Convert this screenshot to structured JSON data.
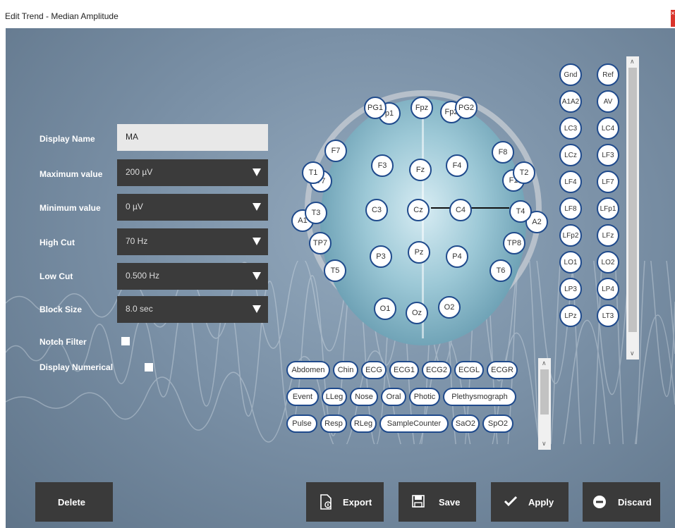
{
  "window": {
    "title": "Edit Trend - Median Amplitude",
    "close_glyph": "×"
  },
  "form": {
    "display_name_label": "Display Name",
    "display_name_value": "MA",
    "max_label": "Maximum value",
    "max_value": "200 µV",
    "min_label": "Minimum value",
    "min_value": "0 µV",
    "high_cut_label": "High Cut",
    "high_cut_value": "70 Hz",
    "low_cut_label": "Low Cut",
    "low_cut_value": "0.500 Hz",
    "block_size_label": "Block Size",
    "block_size_value": "8.0 sec",
    "notch_label": "Notch Filter",
    "numerical_label": "Display Numerical"
  },
  "electrodes": [
    {
      "id": "p1",
      "label": "p1"
    },
    {
      "id": "pg1",
      "label": "PG1"
    },
    {
      "id": "fpz",
      "label": "Fpz"
    },
    {
      "id": "fp2",
      "label": "Fp2"
    },
    {
      "id": "pg2",
      "label": "PG2"
    },
    {
      "id": "f7",
      "label": "F7"
    },
    {
      "id": "f3",
      "label": "F3"
    },
    {
      "id": "fz",
      "label": "Fz"
    },
    {
      "id": "f4",
      "label": "F4"
    },
    {
      "id": "f8",
      "label": "F8"
    },
    {
      "id": "t7",
      "label": "T7"
    },
    {
      "id": "t1",
      "label": "T1"
    },
    {
      "id": "f1",
      "label": "F1"
    },
    {
      "id": "t2",
      "label": "T2"
    },
    {
      "id": "a1",
      "label": "A1"
    },
    {
      "id": "t3",
      "label": "T3"
    },
    {
      "id": "c3",
      "label": "C3"
    },
    {
      "id": "cz",
      "label": "Cz"
    },
    {
      "id": "c4",
      "label": "C4"
    },
    {
      "id": "a2",
      "label": "A2"
    },
    {
      "id": "t4",
      "label": "T4"
    },
    {
      "id": "tp7",
      "label": "TP7"
    },
    {
      "id": "tp8",
      "label": "TP8"
    },
    {
      "id": "p3",
      "label": "P3"
    },
    {
      "id": "pz",
      "label": "Pz"
    },
    {
      "id": "p4",
      "label": "P4"
    },
    {
      "id": "t5",
      "label": "T5"
    },
    {
      "id": "t6",
      "label": "T6"
    },
    {
      "id": "o1",
      "label": "O1"
    },
    {
      "id": "oz",
      "label": "Oz"
    },
    {
      "id": "o2",
      "label": "O2"
    }
  ],
  "ref_channels": [
    "Gnd",
    "Ref",
    "A1A2",
    "AV",
    "LC3",
    "LC4",
    "LCz",
    "LF3",
    "LF4",
    "LF7",
    "LF8",
    "LFp1",
    "LFp2",
    "LFz",
    "LO1",
    "LO2",
    "LP3",
    "LP4",
    "LPz",
    "LT3"
  ],
  "aux_channels": [
    "Abdomen",
    "Chin",
    "ECG",
    "ECG1",
    "ECG2",
    "ECGL",
    "ECGR",
    "Event",
    "LLeg",
    "Nose",
    "Oral",
    "Photic",
    "Plethysmograph",
    "Pulse",
    "Resp",
    "RLeg",
    "SampleCounter",
    "SaO2",
    "SpO2"
  ],
  "buttons": {
    "delete": "Delete",
    "export": "Export",
    "save": "Save",
    "apply": "Apply",
    "discard": "Discard"
  }
}
